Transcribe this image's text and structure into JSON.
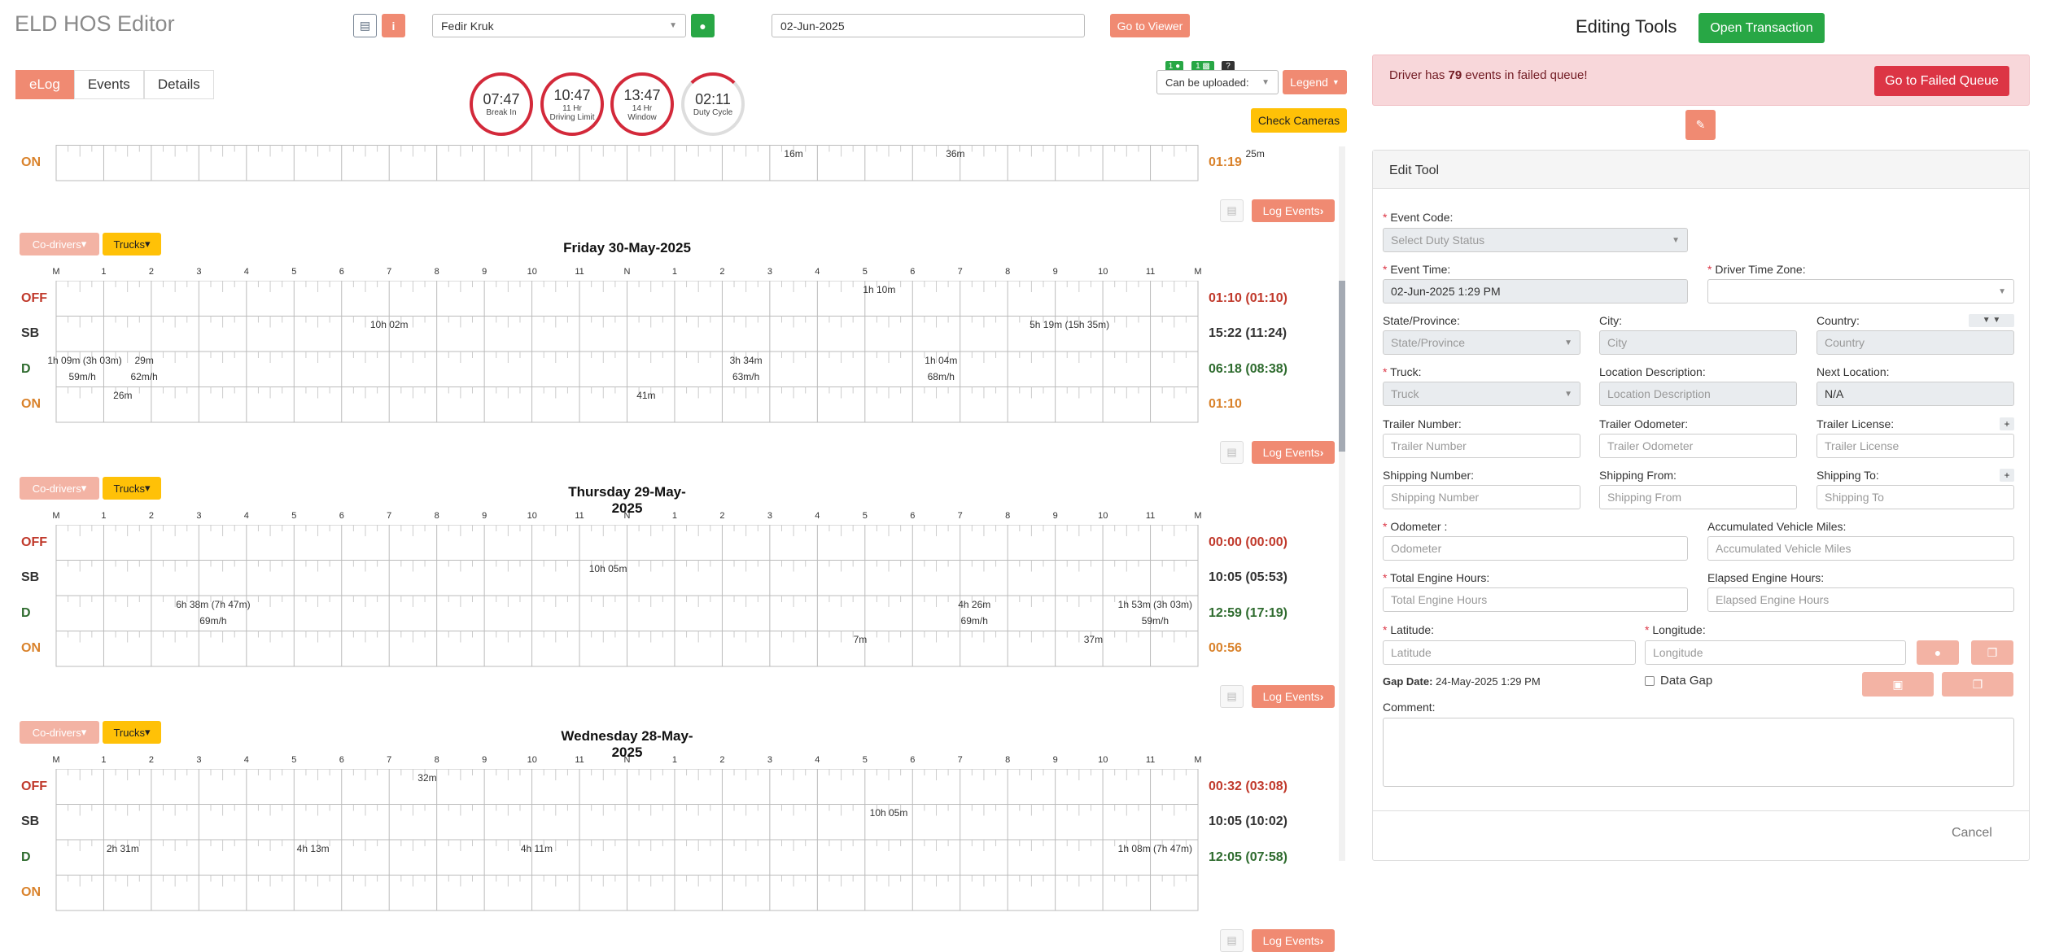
{
  "header": {
    "title": "ELD HOS Editor",
    "driver": "Fedir Kruk",
    "date": "02-Jun-2025",
    "go_to_viewer": "Go to Viewer"
  },
  "tabs": [
    "eLog",
    "Events",
    "Details"
  ],
  "gauges": [
    {
      "value": "07:47",
      "label": "Break In"
    },
    {
      "value": "10:47",
      "label": "11 Hr Driving Limit"
    },
    {
      "value": "13:47",
      "label": "14 Hr Window"
    },
    {
      "value": "02:11",
      "label": "Duty Cycle"
    }
  ],
  "top_controls": {
    "badge1": "1",
    "badge2": "1",
    "badge3": "?",
    "can_upload": "Can be uploaded:",
    "legend": "Legend",
    "check_cameras": "Check Cameras"
  },
  "hours": [
    "M",
    "1",
    "2",
    "3",
    "4",
    "5",
    "6",
    "7",
    "8",
    "9",
    "10",
    "11",
    "N",
    "1",
    "2",
    "3",
    "4",
    "5",
    "6",
    "7",
    "8",
    "9",
    "10",
    "11",
    "M"
  ],
  "row_names": [
    "OFF",
    "SB",
    "D",
    "ON"
  ],
  "common": {
    "co_drivers": "Co-drivers",
    "trucks": "Trucks",
    "log_events": "Log Events"
  },
  "days": [
    {
      "title": "",
      "partial": true,
      "totals": [
        "",
        "",
        "",
        "01:19"
      ],
      "labels": [
        {
          "row": 3,
          "h": 15.5,
          "t": "16m"
        },
        {
          "row": 3,
          "h": 18.9,
          "t": "36m"
        },
        {
          "row": 3,
          "h": 25.2,
          "t": "25m"
        }
      ]
    },
    {
      "title": "Friday 30-May-2025",
      "totals": [
        "01:10 (01:10)",
        "15:22 (11:24)",
        "06:18 (08:38)",
        "01:10"
      ],
      "labels": [
        {
          "row": 1,
          "h": 7.0,
          "t": "10h 02m"
        },
        {
          "row": 2,
          "h": 0.6,
          "t": "1h 09m (3h 03m)"
        },
        {
          "row": 2,
          "h": 0.55,
          "t": "59m/h",
          "sub": true
        },
        {
          "row": 2,
          "h": 1.85,
          "t": "29m"
        },
        {
          "row": 2,
          "h": 1.85,
          "t": "62m/h",
          "sub": true
        },
        {
          "row": 3,
          "h": 1.4,
          "t": "26m"
        },
        {
          "row": 3,
          "h": 12.4,
          "t": "41m"
        },
        {
          "row": 2,
          "h": 14.5,
          "t": "3h 34m"
        },
        {
          "row": 2,
          "h": 14.5,
          "t": "63m/h",
          "sub": true
        },
        {
          "row": 0,
          "h": 17.3,
          "t": "1h 10m"
        },
        {
          "row": 2,
          "h": 18.6,
          "t": "1h 04m"
        },
        {
          "row": 2,
          "h": 18.6,
          "t": "68m/h",
          "sub": true
        },
        {
          "row": 1,
          "h": 21.3,
          "t": "5h 19m (15h 35m)"
        }
      ]
    },
    {
      "title": "Thursday 29-May-2025",
      "totals": [
        "00:00 (00:00)",
        "10:05 (05:53)",
        "12:59 (17:19)",
        "00:56"
      ],
      "labels": [
        {
          "row": 2,
          "h": 3.3,
          "t": "6h 38m (7h 47m)"
        },
        {
          "row": 2,
          "h": 3.3,
          "t": "69m/h",
          "sub": true
        },
        {
          "row": 1,
          "h": 11.6,
          "t": "10h 05m"
        },
        {
          "row": 3,
          "h": 16.9,
          "t": "7m"
        },
        {
          "row": 2,
          "h": 19.3,
          "t": "4h 26m"
        },
        {
          "row": 2,
          "h": 19.3,
          "t": "69m/h",
          "sub": true
        },
        {
          "row": 3,
          "h": 21.8,
          "t": "37m"
        },
        {
          "row": 2,
          "h": 23.1,
          "t": "1h 53m (3h 03m)"
        },
        {
          "row": 2,
          "h": 23.1,
          "t": "59m/h",
          "sub": true
        }
      ]
    },
    {
      "title": "Wednesday 28-May-2025",
      "totals": [
        "00:32 (03:08)",
        "10:05 (10:02)",
        "12:05 (07:58)",
        ""
      ],
      "labels": [
        {
          "row": 0,
          "h": 7.8,
          "t": "32m"
        },
        {
          "row": 1,
          "h": 17.5,
          "t": "10h 05m"
        },
        {
          "row": 2,
          "h": 1.4,
          "t": "2h 31m"
        },
        {
          "row": 2,
          "h": 5.4,
          "t": "4h 13m"
        },
        {
          "row": 2,
          "h": 10.1,
          "t": "4h 11m"
        },
        {
          "row": 2,
          "h": 23.1,
          "t": "1h 08m (7h 47m)"
        }
      ]
    }
  ],
  "right": {
    "title": "Editing Tools",
    "open_transaction": "Open Transaction",
    "failed_pre": "Driver has ",
    "failed_count": "79",
    "failed_post": " events in failed queue!",
    "go_failed": "Go to Failed Queue",
    "edit_tool": "Edit Tool",
    "event_code_label": "Event Code:",
    "event_code_ph": "Select Duty Status",
    "event_time_label": "Event Time:",
    "event_time_value": "02-Jun-2025 1:29 PM",
    "tz_label": "Driver Time Zone:",
    "state_label": "State/Province:",
    "state_ph": "State/Province",
    "city_label": "City:",
    "city_ph": "City",
    "country_label": "Country:",
    "country_ph": "Country",
    "truck_label": "Truck:",
    "truck_ph": "Truck",
    "locdesc_label": "Location Description:",
    "locdesc_ph": "Location Description",
    "nextloc_label": "Next Location:",
    "nextloc_value": "N/A",
    "trailer_num_label": "Trailer Number:",
    "trailer_num_ph": "Trailer Number",
    "trailer_odo_label": "Trailer Odometer:",
    "trailer_odo_ph": "Trailer Odometer",
    "trailer_lic_label": "Trailer License:",
    "trailer_lic_ph": "Trailer License",
    "ship_num_label": "Shipping Number:",
    "ship_num_ph": "Shipping Number",
    "ship_from_label": "Shipping From:",
    "ship_from_ph": "Shipping From",
    "ship_to_label": "Shipping To:",
    "ship_to_ph": "Shipping To",
    "odometer_label": "Odometer :",
    "odometer_ph": "Odometer",
    "acc_miles_label": "Accumulated Vehicle Miles:",
    "acc_miles_ph": "Accumulated Vehicle Miles",
    "eng_hours_label": "Total Engine Hours:",
    "eng_hours_ph": "Total Engine Hours",
    "elapsed_label": "Elapsed Engine Hours:",
    "elapsed_ph": "Elapsed Engine Hours",
    "lat_label": "Latitude:",
    "lat_ph": "Latitude",
    "lon_label": "Longitude:",
    "lon_ph": "Longitude",
    "gap_label": "Gap Date:",
    "gap_value": "24-May-2025 1:29 PM",
    "data_gap": "Data Gap",
    "comment_label": "Comment:",
    "cancel": "Cancel"
  },
  "colors": {
    "off": "#c0392b",
    "sb": "#333333",
    "d": "#2e6b2e",
    "on": "#d9822b",
    "accent": "#f08a72"
  }
}
